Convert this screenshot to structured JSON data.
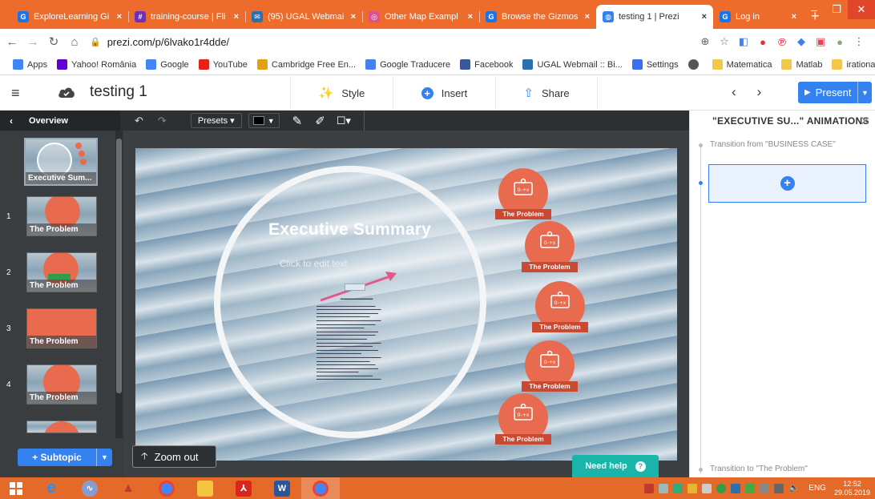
{
  "browser": {
    "tabs": [
      {
        "title": "ExploreLearning Gi",
        "favicon_color": "#1a73e8",
        "favicon_letter": "G",
        "active": false
      },
      {
        "title": "training-course | Fli",
        "favicon_color": "#6d2fbd",
        "favicon_letter": "#",
        "active": false
      },
      {
        "title": "(95) UGAL Webmai",
        "favicon_color": "#2a6fb0",
        "favicon_letter": "✉",
        "active": false
      },
      {
        "title": "Other Map Exampl",
        "favicon_color": "#e04f8f",
        "favicon_letter": "◎",
        "active": false
      },
      {
        "title": "Browse the Gizmos",
        "favicon_color": "#1a73e8",
        "favicon_letter": "G",
        "active": false
      },
      {
        "title": "testing 1 | Prezi",
        "favicon_color": "#3481f0",
        "favicon_letter": "◍",
        "active": true
      },
      {
        "title": "Log in",
        "favicon_color": "#1a73e8",
        "favicon_letter": "G",
        "active": false
      }
    ],
    "url": "prezi.com/p/6lvako1r4dde/",
    "bookmarks": [
      {
        "label": "Apps",
        "color": "#4285f4"
      },
      {
        "label": "Yahoo! România",
        "color": "#5f01d1"
      },
      {
        "label": "Google",
        "color": "#4285f4"
      },
      {
        "label": "YouTube",
        "color": "#e62117"
      },
      {
        "label": "Cambridge Free En...",
        "color": "#e2a013"
      },
      {
        "label": "Google Traducere",
        "color": "#4a7ff0"
      },
      {
        "label": "Facebook",
        "color": "#3b5998"
      },
      {
        "label": "UGAL Webmail :: Bi...",
        "color": "#2a6fb0"
      },
      {
        "label": "Settings",
        "color": "#3c6ef0"
      },
      {
        "label": "",
        "color": "#555555"
      },
      {
        "label": "Matematica",
        "color": "#f2c84b"
      },
      {
        "label": "Matlab",
        "color": "#f2c84b"
      },
      {
        "label": "irationalitatea",
        "color": "#f2c84b"
      }
    ],
    "bookmarks_more": "»"
  },
  "prezi": {
    "doc_title": "testing 1",
    "actions": {
      "style": "Style",
      "insert": "Insert",
      "share": "Share"
    },
    "present_label": "Present",
    "toolbar": {
      "overview": "Overview",
      "presets": "Presets ▾"
    },
    "slides": [
      {
        "num": "",
        "label": "Executive Sum..."
      },
      {
        "num": "1",
        "label": "The Problem"
      },
      {
        "num": "2",
        "label": "The Problem"
      },
      {
        "num": "3",
        "label": "The Problem"
      },
      {
        "num": "4",
        "label": "The Problem"
      }
    ],
    "subtopic_label": "+ Subtopic",
    "canvas": {
      "title": "Executive Summary",
      "placeholder": "Click to edit text",
      "problem_label": "The Problem",
      "zoom_out": "Zoom out",
      "need_help": "Need help"
    },
    "animations": {
      "header": "\"EXECUTIVE SU...\" ANIMATIONS",
      "transition_from": "Transition from \"BUSINESS CASE\"",
      "transition_to": "Transition to \"The Problem\""
    }
  },
  "taskbar": {
    "language": "ENG",
    "time": "12:52",
    "date": "29.05.2019"
  },
  "colors": {
    "accent_orange": "#ed6b2b",
    "prezi_blue": "#3481f0",
    "problem_coral": "#e86b4f",
    "help_teal": "#19b5a9"
  }
}
